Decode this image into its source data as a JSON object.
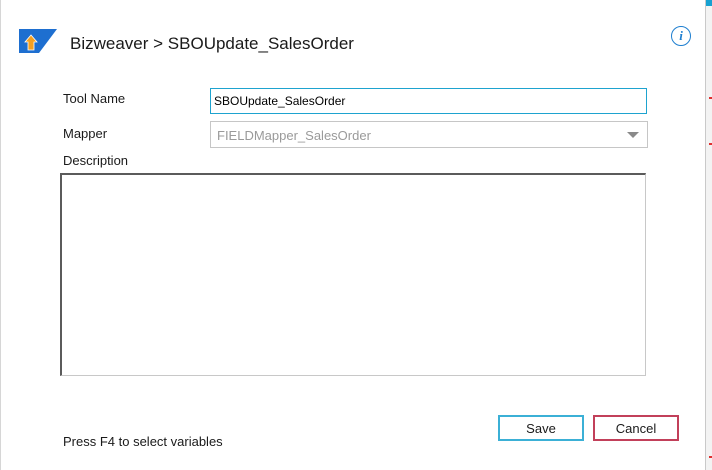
{
  "header": {
    "title": "Bizweaver > SBOUpdate_SalesOrder",
    "info_icon": "info-icon"
  },
  "form": {
    "tool_name_label": "Tool Name",
    "tool_name_value": "SBOUpdate_SalesOrder",
    "mapper_label": "Mapper",
    "mapper_value": "FIELDMapper_SalesOrder",
    "description_label": "Description",
    "description_value": ""
  },
  "footer": {
    "hint": "Press F4 to select variables",
    "save_label": "Save",
    "cancel_label": "Cancel"
  },
  "colors": {
    "accent": "#17a1d1",
    "logo_blue": "#1e6fd0",
    "logo_orange": "#f5a020",
    "save_border": "#3bb0d6",
    "cancel_border": "#c2405a",
    "info_blue": "#1e7fd0"
  }
}
